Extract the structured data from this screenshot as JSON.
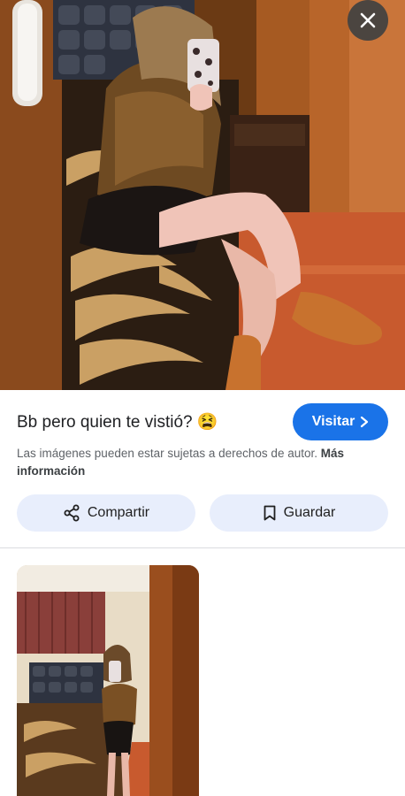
{
  "result": {
    "title": "Bb pero quien te vistió? 😫",
    "visit_label": "Visitar",
    "notice_text": "Las imágenes pueden estar sujetas a derechos de autor.",
    "notice_link": "Más información"
  },
  "actions": {
    "share_label": "Compartir",
    "save_label": "Guardar"
  },
  "colors": {
    "accent": "#1a73e8",
    "pill_bg": "#e8eefc",
    "close_bg": "#4b4540"
  },
  "icons": [
    "close-icon",
    "chevron-right-icon",
    "share-icon",
    "bookmark-icon"
  ]
}
